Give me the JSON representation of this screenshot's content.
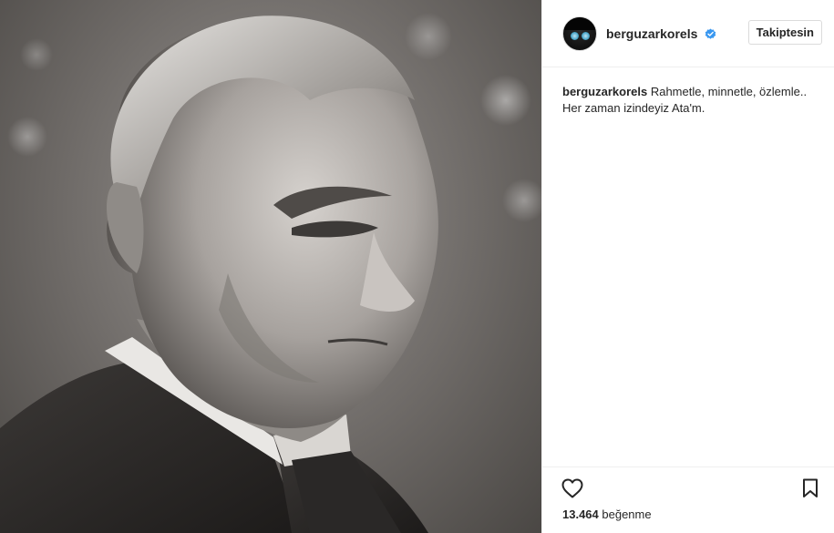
{
  "post": {
    "photo": {
      "description_icon": "portrait-photo"
    },
    "header": {
      "username": "berguzarkorels",
      "verified_icon": "verified-badge-icon",
      "follow_label": "Takiptesin"
    },
    "caption": {
      "username": "berguzarkorels",
      "text_line1": "Rahmetle, minnetle, özlemle..",
      "text_line2": "Her zaman izindeyiz Ata'm."
    },
    "actions": {
      "like_icon": "heart-icon",
      "save_icon": "bookmark-icon",
      "likes_count": "13.464",
      "likes_label": "beğenme"
    },
    "colors": {
      "text": "#262626",
      "border": "#efefef",
      "verified": "#3897f0"
    }
  }
}
